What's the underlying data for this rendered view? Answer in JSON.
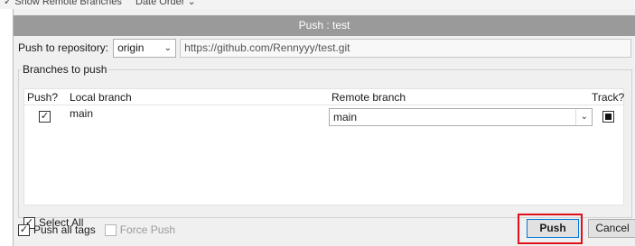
{
  "background_window": {
    "text1": "✓ Show Remote Branches",
    "text2": "Date Order ⌄"
  },
  "dialog": {
    "title": "Push : test",
    "repository_label": "Push to repository:",
    "repository_value": "origin",
    "repository_url": "https://github.com/Rennyyy/test.git",
    "branches_group_label": "Branches to push",
    "columns": [
      "Push?",
      "Local branch",
      "Remote branch",
      "Track?"
    ],
    "rows": [
      {
        "push": true,
        "local_branch": "main",
        "remote_branch": "main",
        "track": true
      }
    ],
    "select_all_label": "Select All",
    "select_all_checked": true,
    "push_all_tags_label": "Push all tags",
    "push_all_tags_checked": true,
    "force_push_label": "Force Push",
    "force_push_checked": false,
    "push_button": "Push",
    "cancel_button": "Cancel",
    "highlight_color": "#e0101a",
    "title_bar_color": "#9a9a9a"
  },
  "icons": {
    "dropdown": "chevron-down-icon",
    "checkmark": "checkmark-icon"
  }
}
